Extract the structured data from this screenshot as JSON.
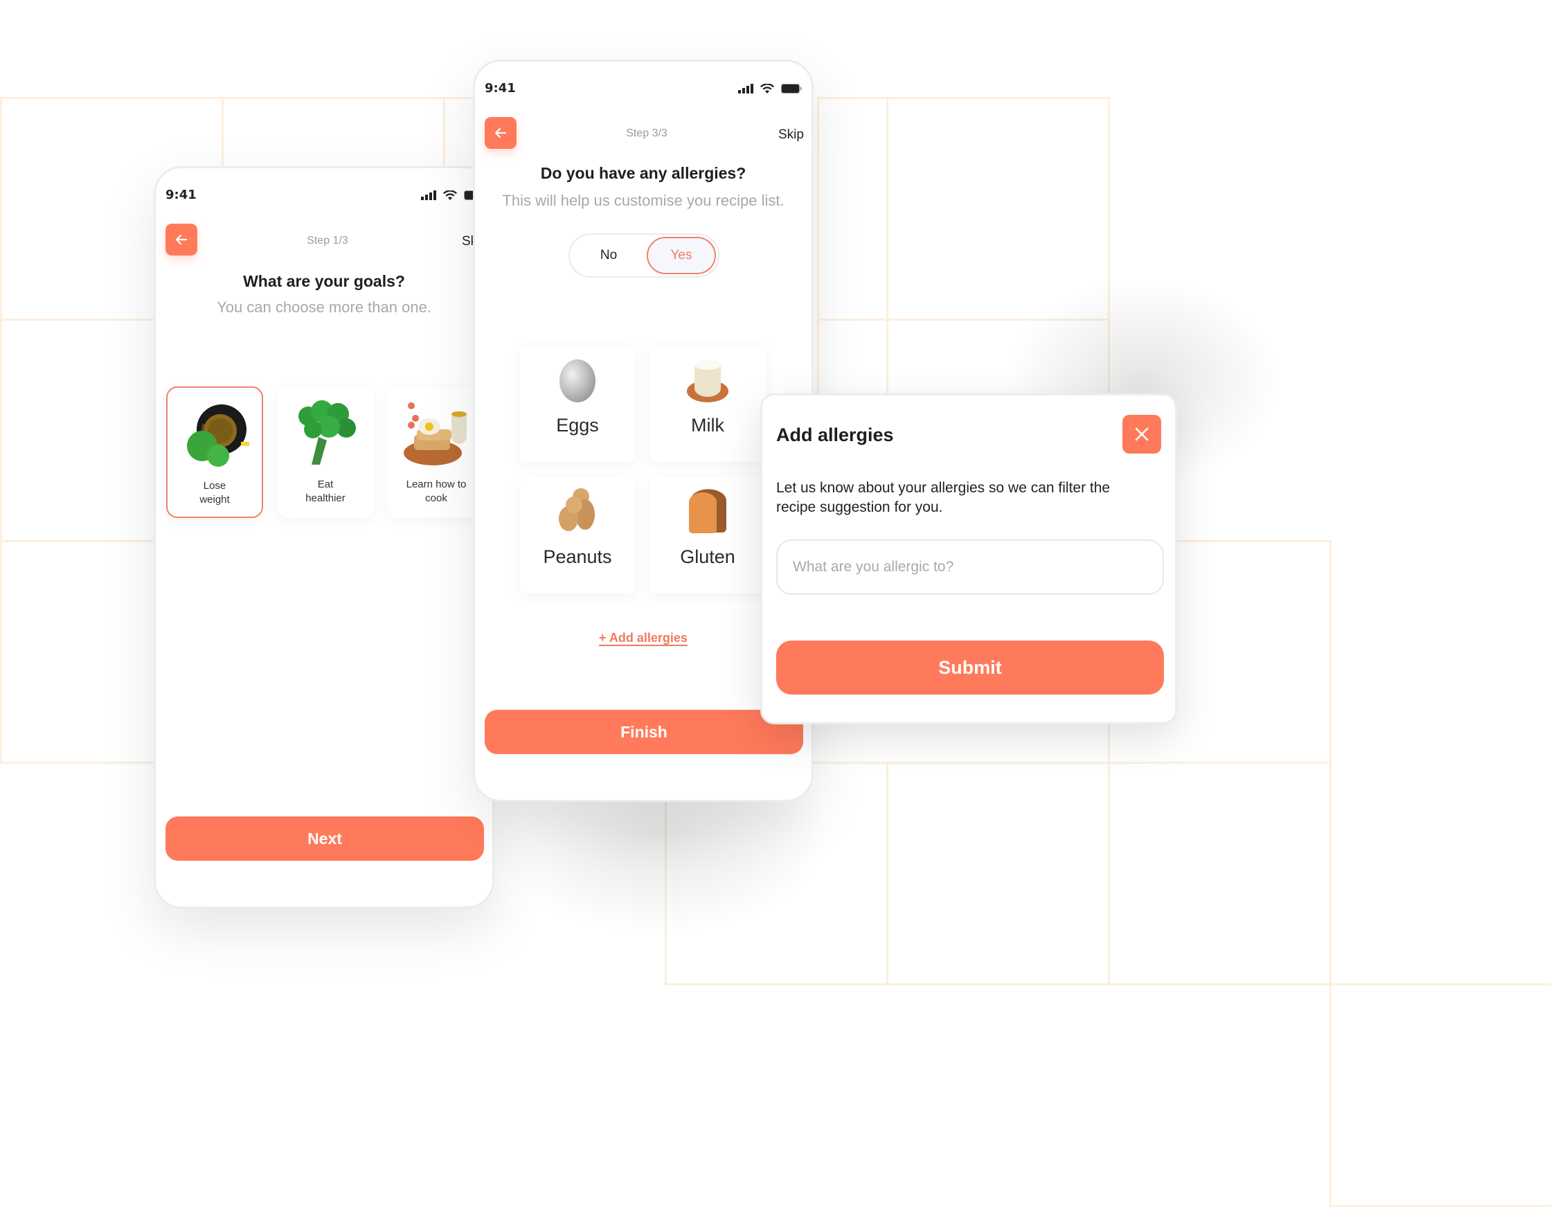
{
  "colors": {
    "accent": "#ff7a5a",
    "grid": "#fcefdf",
    "muted_text": "#a8a8a8"
  },
  "screen1": {
    "status_time": "9:41",
    "status_icons": [
      "signal-icon",
      "wifi-icon",
      "battery-icon"
    ],
    "back_icon": "arrow-left-icon",
    "step": "Step 1/3",
    "skip": "Skip",
    "title": "What are your goals?",
    "subtitle": "You can choose more than one.",
    "goals": [
      {
        "label_line1": "Lose",
        "label_line2": "weight",
        "icon": "apple-tape-measure-icon",
        "selected": true
      },
      {
        "label_line1": "Eat",
        "label_line2": "healthier",
        "icon": "broccoli-icon",
        "selected": false
      },
      {
        "label_line1": "Learn how to",
        "label_line2": "cook",
        "icon": "breakfast-plate-icon",
        "selected": false
      }
    ],
    "next_label": "Next"
  },
  "screen3": {
    "status_time": "9:41",
    "status_icons": [
      "signal-icon",
      "wifi-icon",
      "battery-icon"
    ],
    "back_icon": "arrow-left-icon",
    "step": "Step 3/3",
    "skip": "Skip",
    "title": "Do you have any allergies?",
    "subtitle": "This will help us customise you recipe list.",
    "toggle": {
      "no": "No",
      "yes": "Yes",
      "selected": "Yes"
    },
    "allergies": [
      {
        "label": "Eggs",
        "icon": "egg-icon"
      },
      {
        "label": "Milk",
        "icon": "milk-cup-icon"
      },
      {
        "label": "Peanuts",
        "icon": "peanut-icon"
      },
      {
        "label": "Gluten",
        "icon": "bread-icon"
      }
    ],
    "add_link": "+ Add allergies",
    "finish_label": "Finish"
  },
  "modal": {
    "title": "Add allergies",
    "close_icon": "close-icon",
    "description": "Let us know about your allergies so we can filter the recipe suggestion for you.",
    "input_placeholder": "What are you allergic to?",
    "input_value": "",
    "submit_label": "Submit"
  }
}
